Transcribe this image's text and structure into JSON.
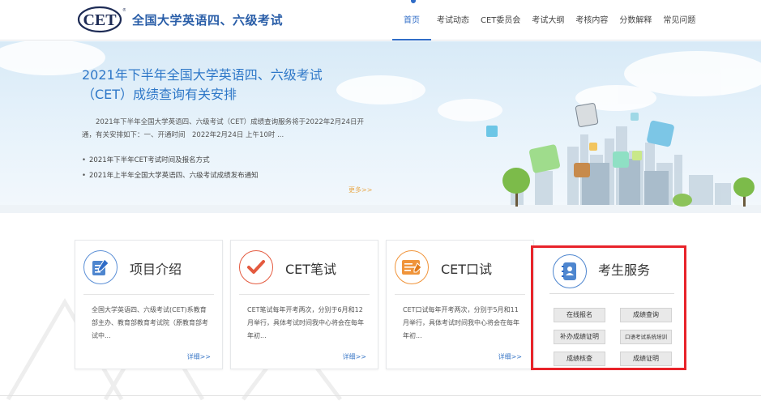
{
  "header": {
    "logo_text": "CET",
    "site_title": "全国大学英语四、六级考试",
    "nav": [
      {
        "label": "首页",
        "active": true
      },
      {
        "label": "考试动态",
        "active": false
      },
      {
        "label": "CET委员会",
        "active": false
      },
      {
        "label": "考试大纲",
        "active": false
      },
      {
        "label": "考核内容",
        "active": false
      },
      {
        "label": "分数解释",
        "active": false
      },
      {
        "label": "常见问题",
        "active": false
      }
    ]
  },
  "banner": {
    "title_line1": "2021年下半年全国大学英语四、六级考试",
    "title_line2": "（CET）成绩查询有关安排",
    "description": "2021年下半年全国大学英语四、六级考试（CET）成绩查询服务将于2022年2月24日开通，有关安排如下：一、开通时间　2022年2月24日 上午10时 ...",
    "links": [
      "2021年下半年CET考试时间及报名方式",
      "2021年上半年全国大学英语四、六级考试成绩发布通知"
    ],
    "more": "更多>>"
  },
  "cards": [
    {
      "title": "项目介绍",
      "icon": "document-edit-icon",
      "desc": "全国大学英语四、六级考试(CET)系教育部主办、教育部教育考试院（原教育部考试中...",
      "more": "详细>>"
    },
    {
      "title": "CET笔试",
      "icon": "checkmark-icon",
      "desc": "CET笔试每年开考两次，分别于6月和12月举行，具体考试时间我中心将会在每年年初...",
      "more": "详细>>"
    },
    {
      "title": "CET口试",
      "icon": "exam-paper-icon",
      "desc": "CET口试每年开考两次，分别于5月和11月举行，具体考试时间我中心将会在每年年初...",
      "more": "详细>>"
    }
  ],
  "service": {
    "title": "考生服务",
    "icon": "contact-book-icon",
    "buttons": [
      "在线报名",
      "成绩查询",
      "补办成绩证明",
      "口语考试系统培训",
      "成绩核查",
      "成绩证明"
    ]
  },
  "colors": {
    "brand_blue": "#2f6cc7",
    "highlight_red": "#e8232a",
    "more_orange": "#e8a94c"
  }
}
